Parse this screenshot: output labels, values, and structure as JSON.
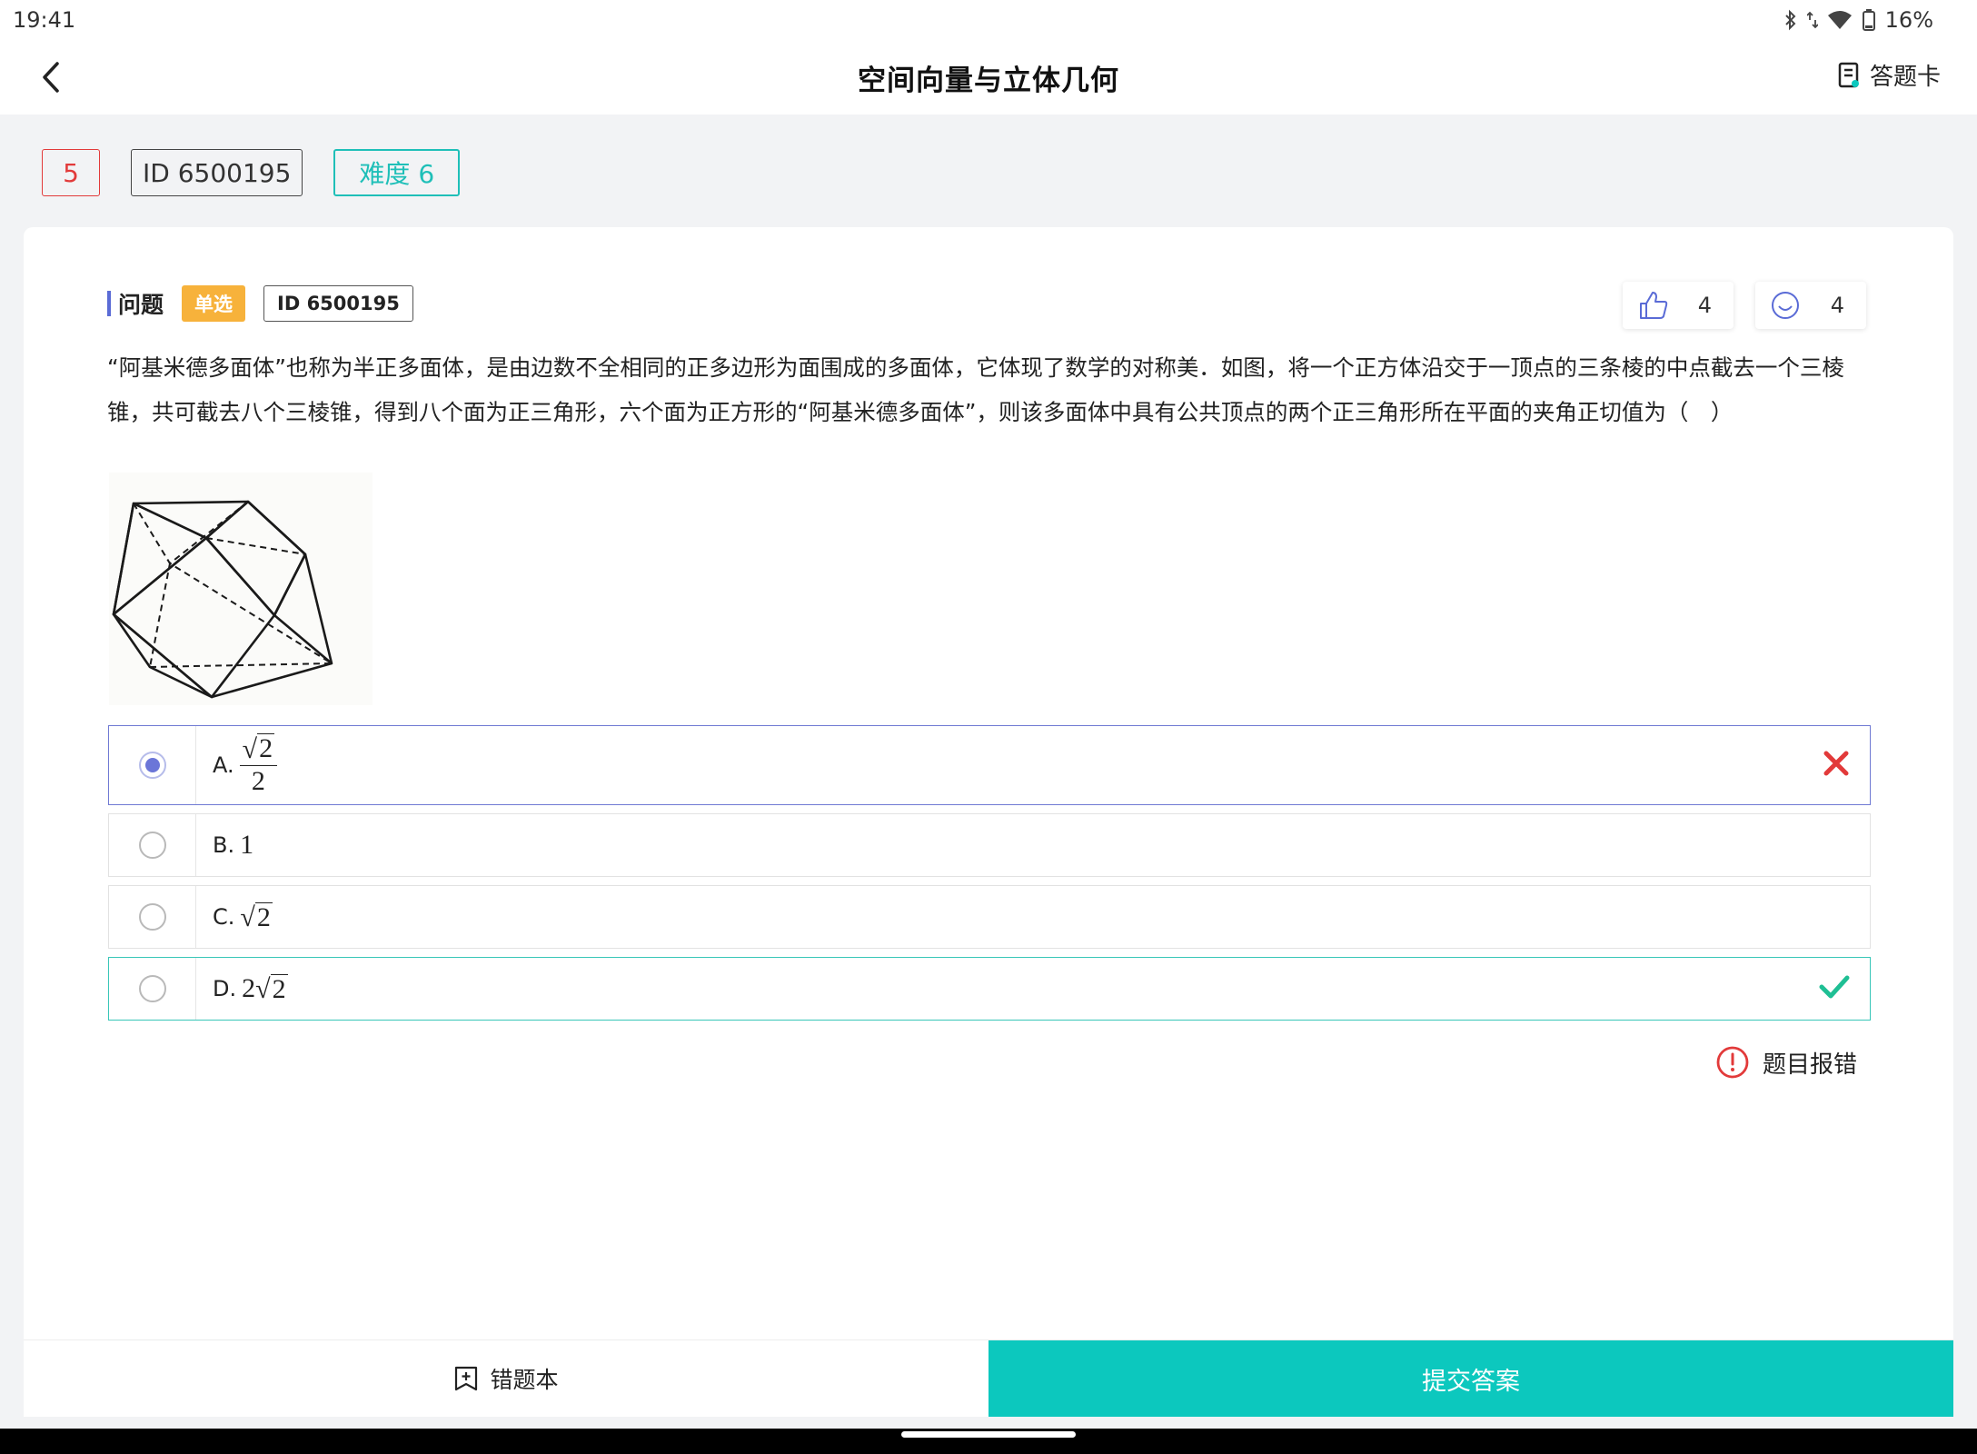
{
  "status_bar": {
    "time": "19:41",
    "battery": "16%"
  },
  "header": {
    "title": "空间向量与立体几何",
    "answer_card": "答题卡"
  },
  "tags": {
    "number": "5",
    "id": "ID 6500195",
    "difficulty": "难度 6"
  },
  "question": {
    "label": "问题",
    "type_badge": "单选",
    "id_badge": "ID 6500195",
    "likes": "4",
    "smiles": "4",
    "text": "“阿基米德多面体”也称为半正多面体，是由边数不全相同的正多边形为面围成的多面体，它体现了数学的对称美．如图，将一个正方体沿交于一顶点的三条棱的中点截去一个三棱锥，共可截去八个三棱锥，得到八个面为正三角形，六个面为正方形的“阿基米德多面体”，则该多面体中具有公共顶点的两个正三角形所在平面的夹角正切值为（　）"
  },
  "options": [
    {
      "letter": "A.",
      "num_part": "2",
      "den_part": "2",
      "state": "selected-wrong"
    },
    {
      "letter": "B.",
      "value": "1",
      "state": "none"
    },
    {
      "letter": "C.",
      "radicand": "2",
      "state": "none"
    },
    {
      "letter": "D.",
      "coef": "2",
      "radicand": "2",
      "state": "correct"
    }
  ],
  "report": "题目报错",
  "bottom": {
    "wrong_book": "错题本",
    "submit": "提交答案"
  },
  "colors": {
    "accent": "#0cc8be",
    "wrong": "#e23a3a",
    "selected": "#6b76d8",
    "badge": "#f7b23b"
  }
}
